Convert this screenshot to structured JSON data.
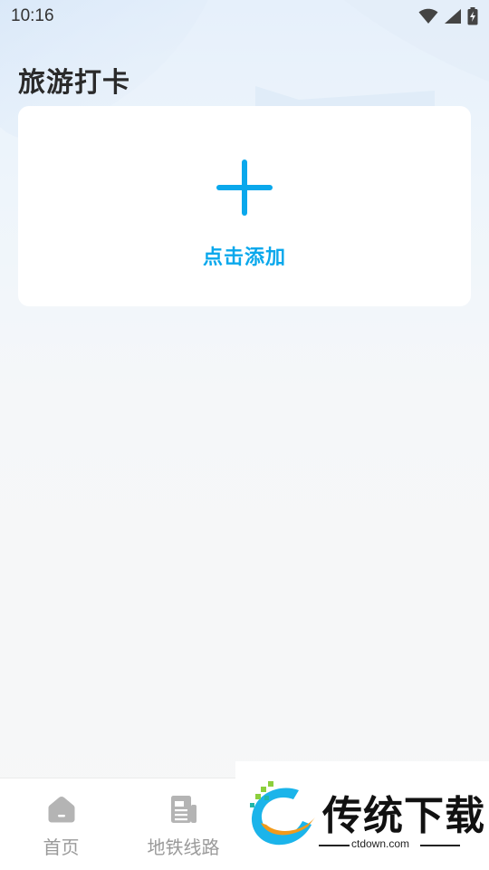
{
  "status_bar": {
    "time": "10:16",
    "icons": [
      "wifi-icon",
      "cellular-signal-icon",
      "battery-charging-icon"
    ]
  },
  "page": {
    "title": "旅游打卡"
  },
  "add_card": {
    "icon": "plus-icon",
    "label": "点击添加",
    "accent_color": "#0aa8ec"
  },
  "tab_bar": {
    "items": [
      {
        "label": "首页",
        "icon": "home-icon"
      },
      {
        "label": "地铁线路",
        "icon": "document-list-icon"
      }
    ]
  },
  "watermark": {
    "brand": "传统下载",
    "url": "ctdown.com"
  }
}
